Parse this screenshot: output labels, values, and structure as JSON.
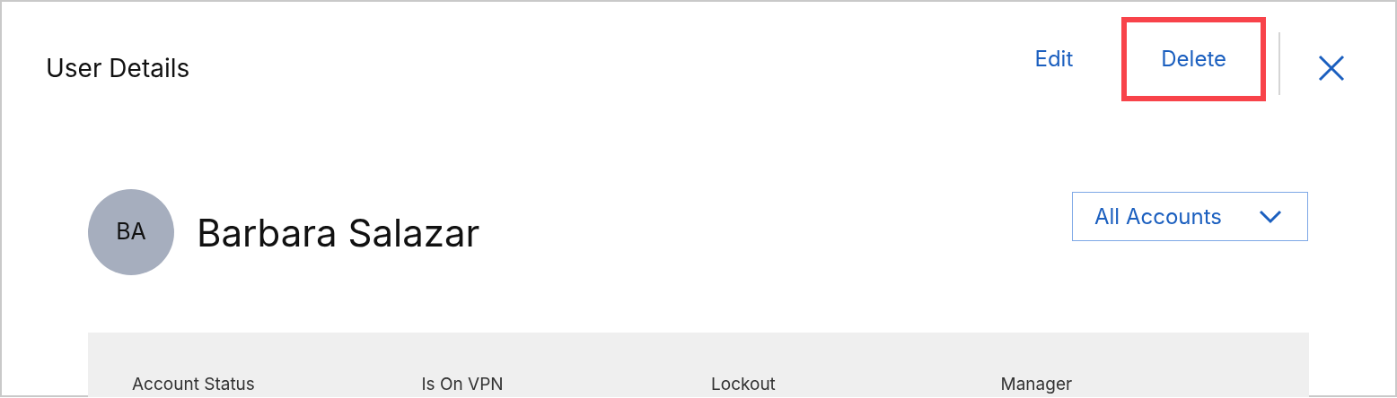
{
  "header": {
    "title": "User Details",
    "actions": [
      {
        "label": "Edit",
        "highlighted": false
      },
      {
        "label": "Delete",
        "highlighted": true
      }
    ]
  },
  "user": {
    "initials": "BA",
    "name": "Barbara Salazar"
  },
  "account_filter": {
    "value": "All Accounts"
  },
  "details": {
    "labels": [
      "Account Status",
      "Is On VPN",
      "Lockout",
      "Manager"
    ]
  }
}
